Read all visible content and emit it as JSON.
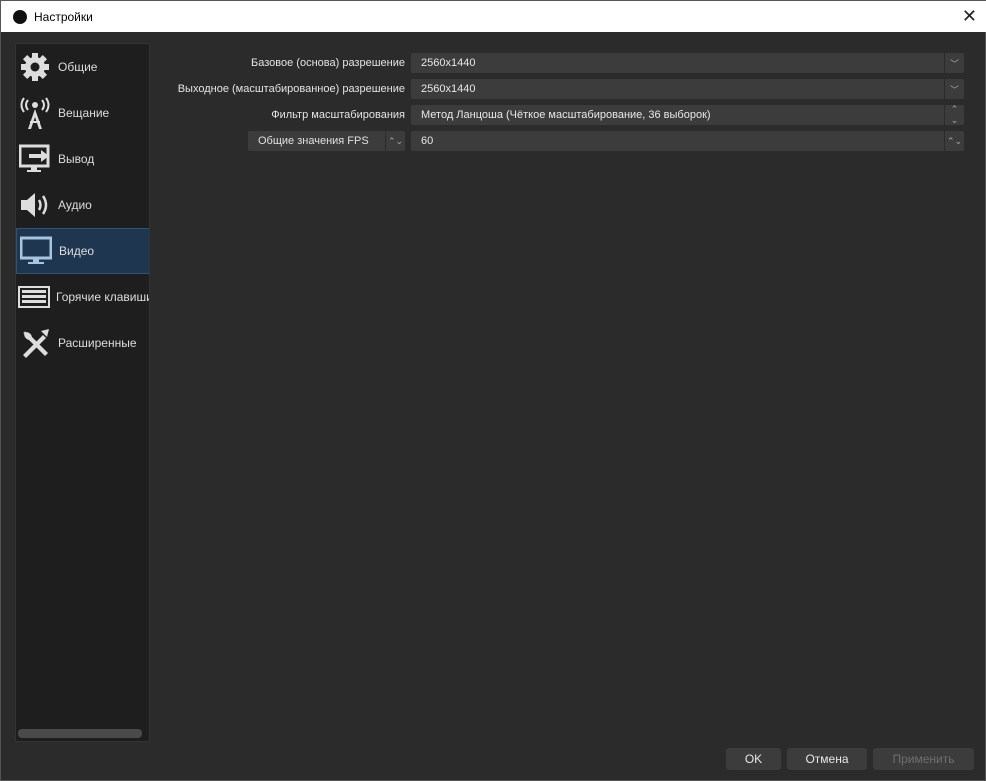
{
  "window": {
    "title": "Настройки"
  },
  "sidebar": {
    "items": [
      {
        "label": "Общие",
        "icon": "gear-icon"
      },
      {
        "label": "Вещание",
        "icon": "broadcast-tower-icon"
      },
      {
        "label": "Вывод",
        "icon": "output-monitor-icon"
      },
      {
        "label": "Аудио",
        "icon": "speaker-icon"
      },
      {
        "label": "Видео",
        "icon": "monitor-icon",
        "active": true
      },
      {
        "label": "Горячие клавиши",
        "icon": "keyboard-icon"
      },
      {
        "label": "Расширенные",
        "icon": "tools-icon"
      }
    ]
  },
  "video": {
    "base_resolution": {
      "label": "Базовое (основа) разрешение",
      "value": "2560x1440"
    },
    "output_resolution": {
      "label": "Выходное (масштабированное) разрешение",
      "value": "2560x1440"
    },
    "downscale_filter": {
      "label": "Фильтр масштабирования",
      "value": "Метод Ланцоша (Чёткое масштабирование, 36 выборок)"
    },
    "fps": {
      "type": "Общие значения FPS",
      "value": "60"
    }
  },
  "buttons": {
    "ok": "OK",
    "cancel": "Отмена",
    "apply": "Применить"
  },
  "colors": {
    "active_item": "#1f3650",
    "background": "#2b2b2b"
  }
}
